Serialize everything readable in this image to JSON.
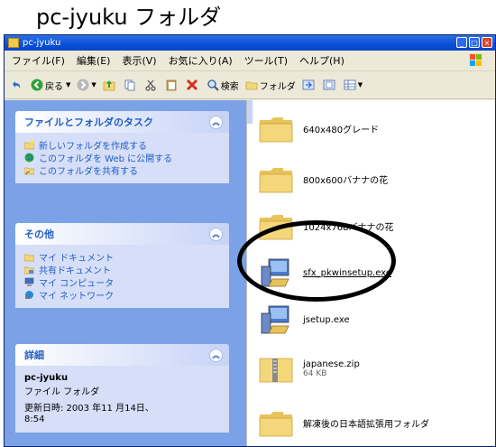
{
  "caption": "pc-jyuku フォルダ",
  "window": {
    "title": "pc-jyuku",
    "buttons": {
      "minimize": "_",
      "maximize": "□",
      "close": "×"
    }
  },
  "menubar": {
    "items": [
      "ファイル(F)",
      "編集(E)",
      "表示(V)",
      "お気に入り(A)",
      "ツール(T)",
      "ヘルプ(H)"
    ]
  },
  "toolbar": {
    "back": "戻る",
    "search": "検索",
    "folders": "フォルダ"
  },
  "tasks": {
    "title": "ファイルとフォルダのタスク",
    "items": [
      "新しいフォルダを作成する",
      "このフォルダを Web に公開する",
      "このフォルダを共有する"
    ]
  },
  "places": {
    "title": "その他",
    "items": [
      "マイ ドキュメント",
      "共有ドキュメント",
      "マイ コンピュータ",
      "マイ ネットワーク"
    ]
  },
  "details": {
    "title": "詳細",
    "name": "pc-jyuku",
    "type": "ファイル フォルダ",
    "modified": "更新日時: 2003 年11 月14日、",
    "time": "8:54"
  },
  "files": [
    {
      "name": "640x480グレード",
      "kind": "folder"
    },
    {
      "name": "800x600バナナの花",
      "kind": "folder"
    },
    {
      "name": "1024x768バナナの花",
      "kind": "folder"
    },
    {
      "name": "sfx_pkwinsetup.exe",
      "kind": "installer"
    },
    {
      "name": "jsetup.exe",
      "kind": "installer"
    },
    {
      "name": "japanese.zip",
      "size": "64 KB",
      "kind": "zip"
    },
    {
      "name": "解凍後の日本語拡張用フォルダ",
      "kind": "folder"
    }
  ],
  "colors": {
    "titlebar": "#0a50d8",
    "taskpane": "#7ba2e7",
    "taskbox": "#d6dff7",
    "link": "#215dc6",
    "folder": "#f4d77a"
  }
}
